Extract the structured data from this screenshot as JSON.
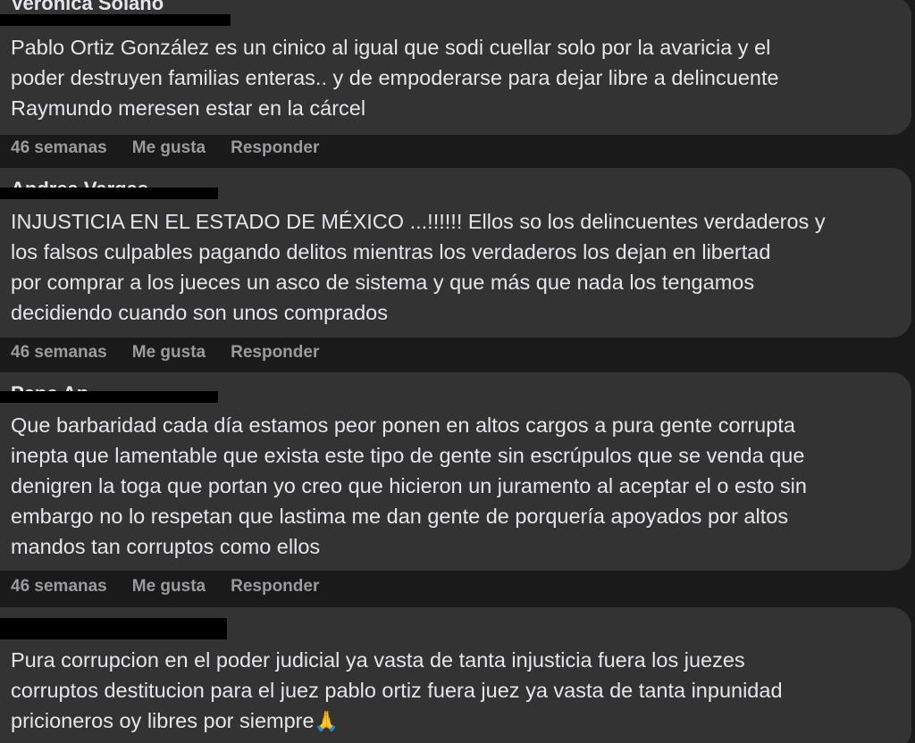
{
  "comments": [
    {
      "author": "Veronica Solano",
      "text": "Pablo Ortiz González es un cinico al igual que sodi cuellar solo por la avaricia y el\npoder destruyen familias enteras.. y de empoderarse para dejar libre a delincuente\nRaymundo meresen estar en la cárcel",
      "time": "46 semanas",
      "like": "Me gusta",
      "reply": "Responder"
    },
    {
      "author": "Andrea Vargas",
      "text": "INJUSTICIA EN EL ESTADO DE MÉXICO ...!!!!!! Ellos so los delincuentes verdaderos y\nlos falsos culpables pagando delitos mientras los verdaderos los dejan en libertad\npor comprar a los jueces un asco de sistema y que más que nada los tengamos\ndecidiendo cuando son unos comprados",
      "time": "46 semanas",
      "like": "Me gusta",
      "reply": "Responder"
    },
    {
      "author": "Pepe Ap",
      "text": "Que barbaridad cada día estamos peor ponen en altos cargos a pura gente corrupta\ninepta que lamentable que exista este tipo de gente sin escrúpulos que se venda que\ndenigren la toga que portan yo creo que hicieron un juramento al aceptar el o esto sin\nembargo no lo respetan que lastima me dan gente de porquería apoyados por altos\nmandos tan corruptos como ellos",
      "time": "46 semanas",
      "like": "Me gusta",
      "reply": "Responder"
    },
    {
      "author": "",
      "text": "Pura corrupcion en el poder judicial ya vasta de tanta injusticia fuera los juezes\ncorruptos destitucion para el juez pablo ortiz fuera juez ya vasta de tanta inpunidad\npricioneros oy libres por siempre",
      "emoji": "🙏",
      "time": "",
      "like": "",
      "reply": ""
    }
  ],
  "colors": {
    "background": "#1a1a1b",
    "bubble": "#333334",
    "text": "#e4e6eb",
    "meta": "#9a9b9f",
    "redaction": "#000000"
  },
  "icons": {
    "prayer": "folded-hands-emoji"
  }
}
